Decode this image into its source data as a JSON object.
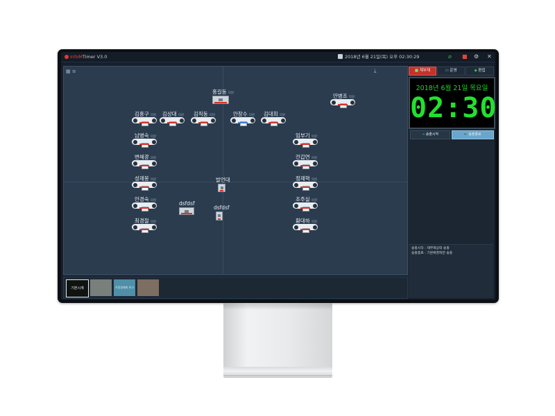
{
  "window": {
    "app_name": "InfoMTimer V3.0",
    "app_brand": "InfoM",
    "app_rest": "Timer V3.0",
    "datetime": "2018년 6월 21일(목) 오후 02:30:29",
    "close_glyph": "✕"
  },
  "toolbar": {
    "tabs": [
      {
        "label": "재부재",
        "active": true
      },
      {
        "label": "운영",
        "active": false
      },
      {
        "label": "편집",
        "active": false
      }
    ]
  },
  "clock": {
    "date": "2018년 6월 21일 목요일",
    "time": "02:30"
  },
  "broadcast": {
    "start_label": "송출시작",
    "end_label": "송출종료"
  },
  "notes": [
    "송출시작 : 재부재상태 송출",
    "송출종료 : 기본배경화면 송출"
  ],
  "seats": [
    {
      "name": "홍길동",
      "tag": "의원"
    },
    {
      "name": "안병조",
      "tag": "의원"
    },
    {
      "name": "김홍구",
      "tag": "의원"
    },
    {
      "name": "김상대",
      "tag": "의원"
    },
    {
      "name": "김직동",
      "tag": "의원"
    },
    {
      "name": "안창수",
      "tag": "의원"
    },
    {
      "name": "김대희",
      "tag": "의원"
    },
    {
      "name": "남병숙",
      "tag": "의원"
    },
    {
      "name": "임부기",
      "tag": "의원"
    },
    {
      "name": "변해광",
      "tag": "의원"
    },
    {
      "name": "전갑연",
      "tag": "의원"
    },
    {
      "name": "성재봉",
      "tag": "의원"
    },
    {
      "name": "정재혁",
      "tag": "의원"
    },
    {
      "name": "안경숙",
      "tag": "의원"
    },
    {
      "name": "조주실",
      "tag": "의원"
    },
    {
      "name": "최경철",
      "tag": "의원"
    },
    {
      "name": "황대하",
      "tag": "의원"
    }
  ],
  "podiums": [
    {
      "name": "발언대"
    },
    {
      "name": "dsfdsf"
    },
    {
      "name": "dsfdsf"
    }
  ],
  "thumbnails": [
    {
      "label": "기본시계"
    },
    {
      "label": ""
    },
    {
      "label": "가정경제회 보고"
    },
    {
      "label": ""
    }
  ],
  "colors": {
    "accent_red": "#d8342a",
    "clock_green": "#23e02e",
    "panel_bg": "#2c3c4f"
  }
}
